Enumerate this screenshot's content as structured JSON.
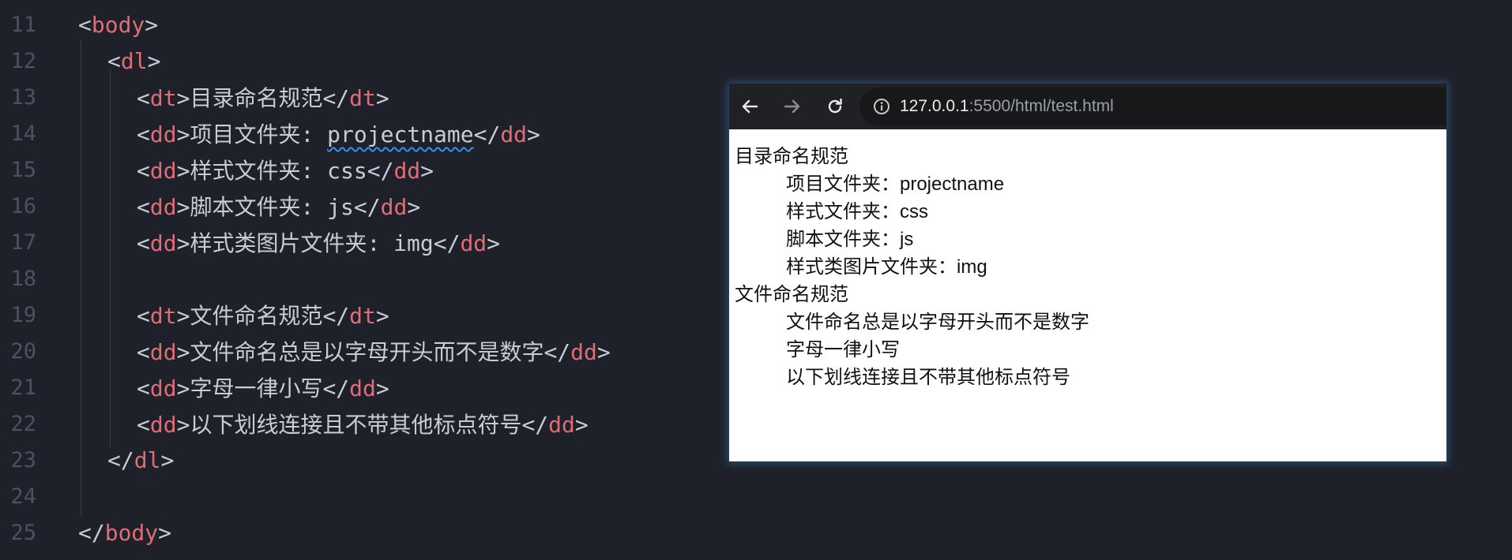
{
  "editor": {
    "lines": [
      {
        "num": "11",
        "tokens": [
          [
            "punct",
            "<"
          ],
          [
            "tag",
            "body"
          ],
          [
            "punct",
            ">"
          ]
        ]
      },
      {
        "num": "12",
        "tokens": [
          [
            "punct",
            "<"
          ],
          [
            "tag",
            "dl"
          ],
          [
            "punct",
            ">"
          ]
        ]
      },
      {
        "num": "13",
        "tokens": [
          [
            "punct",
            "<"
          ],
          [
            "tag",
            "dt"
          ],
          [
            "punct",
            ">"
          ],
          [
            "txt",
            "目录命名规范"
          ],
          [
            "punct",
            "</"
          ],
          [
            "tag",
            "dt"
          ],
          [
            "punct",
            ">"
          ]
        ]
      },
      {
        "num": "14",
        "tokens": [
          [
            "punct",
            "<"
          ],
          [
            "tag",
            "dd"
          ],
          [
            "punct",
            ">"
          ],
          [
            "txt",
            "项目文件夹: "
          ],
          [
            "squiggle",
            "projectname"
          ],
          [
            "punct",
            "</"
          ],
          [
            "tag",
            "dd"
          ],
          [
            "punct",
            ">"
          ]
        ]
      },
      {
        "num": "15",
        "tokens": [
          [
            "punct",
            "<"
          ],
          [
            "tag",
            "dd"
          ],
          [
            "punct",
            ">"
          ],
          [
            "txt",
            "样式文件夹: css"
          ],
          [
            "punct",
            "</"
          ],
          [
            "tag",
            "dd"
          ],
          [
            "punct",
            ">"
          ]
        ]
      },
      {
        "num": "16",
        "tokens": [
          [
            "punct",
            "<"
          ],
          [
            "tag",
            "dd"
          ],
          [
            "punct",
            ">"
          ],
          [
            "txt",
            "脚本文件夹: js"
          ],
          [
            "punct",
            "</"
          ],
          [
            "tag",
            "dd"
          ],
          [
            "punct",
            ">"
          ]
        ]
      },
      {
        "num": "17",
        "tokens": [
          [
            "punct",
            "<"
          ],
          [
            "tag",
            "dd"
          ],
          [
            "punct",
            ">"
          ],
          [
            "txt",
            "样式类图片文件夹: img"
          ],
          [
            "punct",
            "</"
          ],
          [
            "tag",
            "dd"
          ],
          [
            "punct",
            ">"
          ]
        ]
      },
      {
        "num": "18",
        "tokens": []
      },
      {
        "num": "19",
        "tokens": [
          [
            "punct",
            "<"
          ],
          [
            "tag",
            "dt"
          ],
          [
            "punct",
            ">"
          ],
          [
            "txt",
            "文件命名规范"
          ],
          [
            "punct",
            "</"
          ],
          [
            "tag",
            "dt"
          ],
          [
            "punct",
            ">"
          ]
        ]
      },
      {
        "num": "20",
        "tokens": [
          [
            "punct",
            "<"
          ],
          [
            "tag",
            "dd"
          ],
          [
            "punct",
            ">"
          ],
          [
            "txt",
            "文件命名总是以字母开头而不是数字"
          ],
          [
            "punct",
            "</"
          ],
          [
            "tag",
            "dd"
          ],
          [
            "punct",
            ">"
          ]
        ]
      },
      {
        "num": "21",
        "tokens": [
          [
            "punct",
            "<"
          ],
          [
            "tag",
            "dd"
          ],
          [
            "punct",
            ">"
          ],
          [
            "txt",
            "字母一律小写"
          ],
          [
            "punct",
            "</"
          ],
          [
            "tag",
            "dd"
          ],
          [
            "punct",
            ">"
          ]
        ]
      },
      {
        "num": "22",
        "tokens": [
          [
            "punct",
            "<"
          ],
          [
            "tag",
            "dd"
          ],
          [
            "punct",
            ">"
          ],
          [
            "txt",
            "以下划线连接且不带其他标点符号"
          ],
          [
            "punct",
            "</"
          ],
          [
            "tag",
            "dd"
          ],
          [
            "punct",
            ">"
          ]
        ]
      },
      {
        "num": "23",
        "tokens": [
          [
            "punct",
            "</"
          ],
          [
            "tag",
            "dl"
          ],
          [
            "punct",
            ">"
          ]
        ]
      },
      {
        "num": "24",
        "tokens": []
      },
      {
        "num": "25",
        "tokens": [
          [
            "punct",
            "</"
          ],
          [
            "tag",
            "body"
          ],
          [
            "punct",
            ">"
          ]
        ]
      }
    ]
  },
  "browser": {
    "url_host": "127.0.0.1",
    "url_path": ":5500/html/test.html",
    "icons": {
      "back": "arrow-left-icon",
      "forward": "arrow-right-icon",
      "reload": "reload-icon",
      "info": "info-icon"
    },
    "page": {
      "items": [
        {
          "kind": "dt",
          "text": "目录命名规范"
        },
        {
          "kind": "dd",
          "text": "项目文件夹：projectname"
        },
        {
          "kind": "dd",
          "text": "样式文件夹：css"
        },
        {
          "kind": "dd",
          "text": "脚本文件夹：js"
        },
        {
          "kind": "dd",
          "text": "样式类图片文件夹：img"
        },
        {
          "kind": "dt",
          "text": "文件命名规范"
        },
        {
          "kind": "dd",
          "text": "文件命名总是以字母开头而不是数字"
        },
        {
          "kind": "dd",
          "text": "字母一律小写"
        },
        {
          "kind": "dd",
          "text": "以下划线连接且不带其他标点符号"
        }
      ]
    }
  },
  "colors": {
    "editor_bg": "#1e2129",
    "tag": "#e06c75",
    "text": "#c9ccd3",
    "line_number": "#4b5263",
    "browser_toolbar": "#202124"
  }
}
